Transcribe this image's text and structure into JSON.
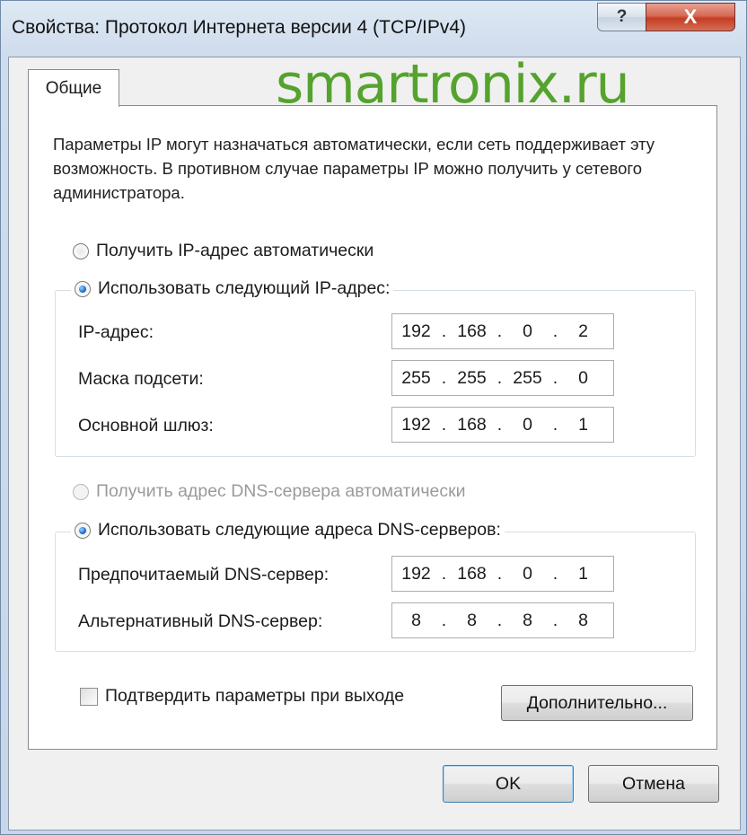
{
  "window": {
    "title": "Свойства: Протокол Интернета версии 4 (TCP/IPv4)",
    "help_glyph": "?",
    "close_glyph": "X"
  },
  "tabs": [
    {
      "label": "Общие",
      "selected": true
    }
  ],
  "watermark": "smartronix.ru",
  "description": "Параметры IP могут назначаться автоматически, если сеть поддерживает эту возможность. В противном случае параметры IP можно получить у сетевого администратора.",
  "ip": {
    "auto_label": "Получить IP-адрес автоматически",
    "manual_label": "Использовать следующий IP-адрес:",
    "selected": "manual",
    "fields": [
      {
        "label": "IP-адрес:",
        "octets": [
          "192",
          "168",
          "0",
          "2"
        ]
      },
      {
        "label": "Маска подсети:",
        "octets": [
          "255",
          "255",
          "255",
          "0"
        ]
      },
      {
        "label": "Основной шлюз:",
        "octets": [
          "192",
          "168",
          "0",
          "1"
        ]
      }
    ]
  },
  "dns": {
    "auto_label": "Получить адрес DNS-сервера автоматически",
    "manual_label": "Использовать следующие адреса DNS-серверов:",
    "selected": "manual",
    "fields": [
      {
        "label": "Предпочитаемый DNS-сервер:",
        "octets": [
          "192",
          "168",
          "0",
          "1"
        ]
      },
      {
        "label": "Альтернативный DNS-сервер:",
        "octets": [
          "8",
          "8",
          "8",
          "8"
        ]
      }
    ]
  },
  "validate_checkbox": {
    "label": "Подтвердить параметры при выходе",
    "checked": false
  },
  "buttons": {
    "advanced": "Дополнительно...",
    "ok": "OK",
    "cancel": "Отмена"
  },
  "colors": {
    "watermark": "#55a32e",
    "close_button": "#c43d23",
    "radio_selected": "#1a6ed0"
  }
}
